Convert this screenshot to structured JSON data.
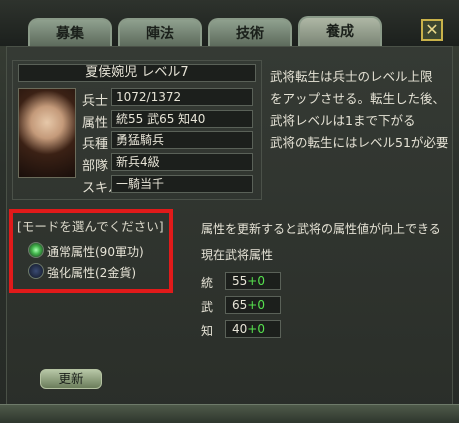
{
  "tabs": [
    {
      "label": "募集",
      "active": false
    },
    {
      "label": "陣法",
      "active": false
    },
    {
      "label": "技術",
      "active": false
    },
    {
      "label": "養成",
      "active": true
    }
  ],
  "close_label": "✕",
  "hero": {
    "name": "夏侯婉児 レベル7",
    "fields": [
      {
        "label": "兵士",
        "value": "1072/1372"
      },
      {
        "label": "属性",
        "value": "統55 武65 知40"
      },
      {
        "label": "兵種",
        "value": "勇猛騎兵"
      },
      {
        "label": "部隊",
        "value": "新兵4級"
      },
      {
        "label": "スキル",
        "value": "一騎当千"
      }
    ]
  },
  "info_lines": [
    "武将転生は兵士のレベル上限",
    "をアップさせる。転生した後、",
    "武将レベルは1まで下がる",
    "武将の転生にはレベル51が必要"
  ],
  "mode": {
    "title": "[モードを選んでください]",
    "options": [
      {
        "label": "通常属性(90軍功)",
        "selected": true
      },
      {
        "label": "強化属性(2金貨)",
        "selected": false
      }
    ]
  },
  "attr_hint": "属性を更新すると武将の属性値が向上できる",
  "current_attr_title": "現在武将属性",
  "stats": [
    {
      "label": "統",
      "value": "55",
      "plus": "+0"
    },
    {
      "label": "武",
      "value": "65",
      "plus": "+0"
    },
    {
      "label": "知",
      "value": "40",
      "plus": "+0"
    }
  ],
  "update_button": "更新"
}
